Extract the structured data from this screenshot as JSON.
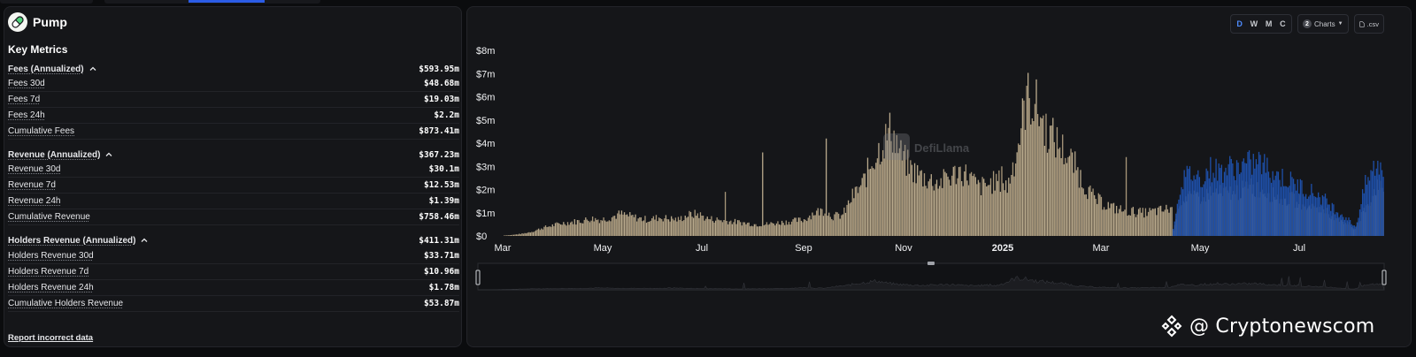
{
  "protocol": {
    "name": "Pump",
    "logo_icon": "pill-icon"
  },
  "key_metrics": {
    "title": "Key Metrics",
    "groups": [
      {
        "label": "Fees (Annualized)",
        "value": "$593.95m",
        "rows": [
          {
            "label": "Fees 30d",
            "value": "$48.68m"
          },
          {
            "label": "Fees 7d",
            "value": "$19.03m"
          },
          {
            "label": "Fees 24h",
            "value": "$2.2m"
          },
          {
            "label": "Cumulative Fees",
            "value": "$873.41m"
          }
        ]
      },
      {
        "label": "Revenue (Annualized)",
        "value": "$367.23m",
        "rows": [
          {
            "label": "Revenue 30d",
            "value": "$30.1m"
          },
          {
            "label": "Revenue 7d",
            "value": "$12.53m"
          },
          {
            "label": "Revenue 24h",
            "value": "$1.39m"
          },
          {
            "label": "Cumulative Revenue",
            "value": "$758.46m"
          }
        ]
      },
      {
        "label": "Holders Revenue (Annualized)",
        "value": "$411.31m",
        "rows": [
          {
            "label": "Holders Revenue 30d",
            "value": "$33.71m"
          },
          {
            "label": "Holders Revenue 7d",
            "value": "$10.96m"
          },
          {
            "label": "Holders Revenue 24h",
            "value": "$1.78m"
          },
          {
            "label": "Cumulative Holders Revenue",
            "value": "$53.87m"
          }
        ]
      }
    ],
    "report_link": "Report incorrect data"
  },
  "toolbar": {
    "granularity": [
      "D",
      "W",
      "M",
      "C"
    ],
    "granularity_active": "D",
    "charts_count": "2",
    "charts_label": "Charts",
    "csv_label": ".csv"
  },
  "colors": {
    "fees_bar": "#b8a98c",
    "holders_bar": "#1e4fa8",
    "accent": "#4e8cff",
    "panel_bg": "#151619"
  },
  "chart_watermark": "DefiLlama",
  "watermark": {
    "text": "@ Cryptonewscom"
  },
  "chart_data": {
    "type": "bar",
    "x_ticks": [
      "Mar",
      "May",
      "Jul",
      "Sep",
      "Nov",
      "2025",
      "Mar",
      "May",
      "Jul"
    ],
    "y_ticks": [
      "$0",
      "$1m",
      "$2m",
      "$3m",
      "$4m",
      "$5m",
      "$6m",
      "$7m",
      "$8m"
    ],
    "ylim": [
      0,
      8
    ],
    "y_unit": "$m",
    "x_range": [
      "2024-03",
      "2025-08"
    ],
    "series": [
      {
        "values_weekly_avg_m": [
          0.02,
          0.05,
          0.1,
          0.2,
          0.35,
          0.45,
          0.55,
          0.6,
          0.65,
          0.75,
          0.7,
          0.8,
          0.95,
          0.85,
          0.75,
          0.7,
          0.8,
          0.75,
          0.7,
          0.9,
          0.95,
          0.75,
          0.7,
          0.65,
          0.6,
          0.55,
          0.5,
          0.5,
          0.55,
          0.6,
          0.65,
          0.7,
          1.0,
          1.1,
          0.85,
          0.9,
          1.7,
          2.2,
          3.2,
          3.9,
          4.6,
          3.5,
          2.9,
          2.6,
          2.4,
          2.3,
          2.5,
          2.8,
          2.6,
          2.1,
          2.2,
          2.4,
          2.1,
          3.7,
          6.0,
          5.6,
          4.6,
          4.1,
          3.6,
          3.0,
          2.2,
          1.6,
          1.4,
          1.2,
          1.1,
          1.05,
          1.0,
          1.05,
          1.1,
          1.2,
          1.6,
          1.8,
          1.7,
          1.9,
          1.85,
          1.9,
          1.95,
          2.0,
          2.1,
          1.9,
          1.7,
          1.6,
          1.5,
          1.4,
          1.3,
          1.0,
          0.8,
          0.6,
          0.3,
          1.2,
          2.1
        ]
      },
      {
        "values_weekly_avg_m": [
          0,
          0,
          0,
          0,
          0,
          0,
          0,
          0,
          0,
          0,
          0,
          0,
          0,
          0,
          0,
          0,
          0,
          0,
          0,
          0,
          0,
          0,
          0,
          0,
          0,
          0,
          0,
          0,
          0,
          0,
          0,
          0,
          0,
          0,
          0,
          0,
          0,
          0,
          0,
          0,
          0,
          0,
          0,
          0,
          0,
          0,
          0,
          0,
          0,
          0,
          0,
          0,
          0,
          0,
          0,
          0,
          0,
          0,
          0,
          0,
          0,
          0,
          0,
          0,
          0,
          0,
          0,
          0,
          0,
          0,
          2.4,
          2.7,
          2.5,
          2.9,
          2.8,
          2.95,
          3.0,
          3.1,
          3.2,
          2.9,
          2.6,
          2.4,
          2.2,
          2.0,
          1.8,
          1.5,
          1.1,
          0.8,
          0.4,
          2.2,
          3.0
        ]
      }
    ]
  }
}
